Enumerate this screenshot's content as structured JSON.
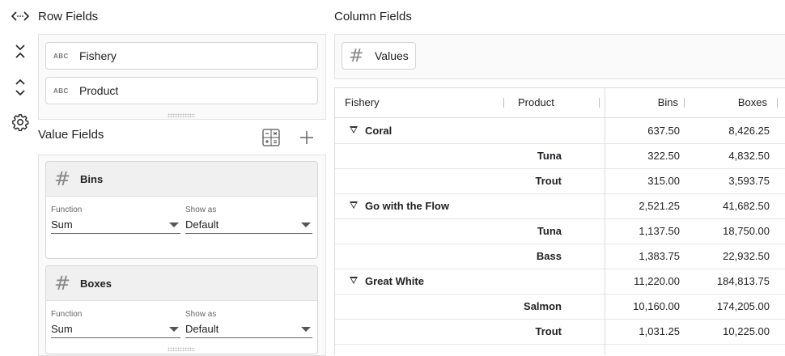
{
  "row_fields": {
    "title": "Row Fields",
    "items": [
      {
        "type": "ABC",
        "label": "Fishery"
      },
      {
        "type": "ABC",
        "label": "Product"
      }
    ]
  },
  "value_fields": {
    "title": "Value Fields",
    "items": [
      {
        "name": "Bins",
        "function_label": "Function",
        "function": "Sum",
        "show_as_label": "Show as",
        "show_as": "Default"
      },
      {
        "name": "Boxes",
        "function_label": "Function",
        "function": "Sum",
        "show_as_label": "Show as",
        "show_as": "Default"
      }
    ]
  },
  "column_fields": {
    "title": "Column Fields",
    "items": [
      {
        "label": "Values"
      }
    ]
  },
  "grid": {
    "headers": {
      "fishery": "Fishery",
      "product": "Product",
      "bins": "Bins",
      "boxes": "Boxes"
    },
    "rows": [
      {
        "fishery": "Coral",
        "product": "",
        "bins": "637.50",
        "boxes": "8,426.25",
        "group": true
      },
      {
        "fishery": "",
        "product": "Tuna",
        "bins": "322.50",
        "boxes": "4,832.50",
        "group": false
      },
      {
        "fishery": "",
        "product": "Trout",
        "bins": "315.00",
        "boxes": "3,593.75",
        "group": false
      },
      {
        "fishery": "Go with the Flow",
        "product": "",
        "bins": "2,521.25",
        "boxes": "41,682.50",
        "group": true
      },
      {
        "fishery": "",
        "product": "Tuna",
        "bins": "1,137.50",
        "boxes": "18,750.00",
        "group": false
      },
      {
        "fishery": "",
        "product": "Bass",
        "bins": "1,383.75",
        "boxes": "22,932.50",
        "group": false
      },
      {
        "fishery": "Great White",
        "product": "",
        "bins": "11,220.00",
        "boxes": "184,813.75",
        "group": true
      },
      {
        "fishery": "",
        "product": "Salmon",
        "bins": "10,160.00",
        "boxes": "174,205.00",
        "group": false
      },
      {
        "fishery": "",
        "product": "Trout",
        "bins": "1,031.25",
        "boxes": "10,225.00",
        "group": false
      }
    ]
  },
  "icons": {
    "swap": "swap-horizontal-icon",
    "collapse": "collapse-vertical-icon",
    "expand": "expand-vertical-icon",
    "settings": "gear-icon",
    "calculator": "calculator-icon",
    "add": "plus-icon"
  }
}
